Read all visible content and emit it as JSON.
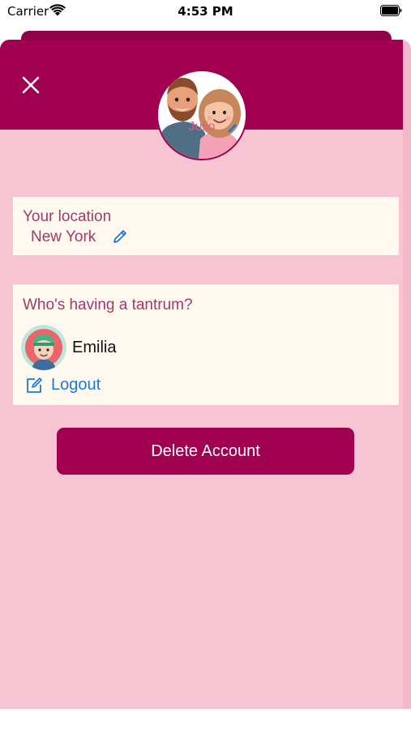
{
  "status_bar": {
    "carrier": "Carrier",
    "time": "4:53 PM"
  },
  "profile": {
    "name": "Julio"
  },
  "location": {
    "label": "Your location",
    "value": "New York"
  },
  "tantrum": {
    "label": "Who's having a tantrum?",
    "child_name": "Emilia",
    "logout_label": "Logout"
  },
  "actions": {
    "delete_label": "Delete Account"
  },
  "colors": {
    "header": "#a0004f",
    "background": "#f7c4d3",
    "card": "#fff9f0",
    "label_text": "#a03a66",
    "link": "#1a7ad8"
  },
  "icons": {
    "close": "close-icon",
    "edit": "pencil-icon",
    "logout": "edit-square-icon"
  }
}
